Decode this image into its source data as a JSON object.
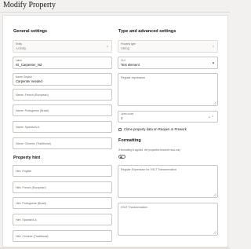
{
  "page": {
    "title": "Modify Property"
  },
  "general": {
    "title": "General settings",
    "entity": {
      "label": "Entity",
      "value": "Activity"
    },
    "label": {
      "label": "Label",
      "value": "IG_Carpenter_Nd"
    },
    "name_english": {
      "label": "Name: English",
      "value": "Carpenter needed"
    },
    "name_french": {
      "placeholder": "Name: French (European)"
    },
    "name_portuguese": {
      "placeholder": "Name: Portuguese (Brazil)"
    },
    "name_spanish": {
      "placeholder": "Name: Spanish/LA"
    },
    "name_chinese": {
      "placeholder": "Name: Chinese (Traditional)"
    }
  },
  "type_advanced": {
    "title": "Type and advanced settings",
    "property_type": {
      "label": "Property type",
      "value": "String"
    },
    "gui": {
      "label": "GUI",
      "value": "Text element"
    },
    "regex": {
      "placeholder": "Regular expression"
    },
    "lines_count": {
      "label": "Lines count",
      "value": "1"
    },
    "clone_checkbox": {
      "label": "Clone property data on Reopen or Prework",
      "checked": false
    }
  },
  "formatting": {
    "title": "Formatting",
    "hint": "If formatting is applied, the properties become read-only",
    "toggle_on": false,
    "regex_xslt": {
      "placeholder": "Regular Expression for XSLT Transformation"
    },
    "xslt": {
      "placeholder": "XSLT Transformation"
    }
  },
  "property_hint": {
    "title": "Property hint",
    "hint_english": {
      "placeholder": "Hint: English"
    },
    "hint_french": {
      "placeholder": "Hint: French (European)"
    },
    "hint_portuguese": {
      "placeholder": "Hint: Portuguese (Brazil)"
    },
    "hint_spanish": {
      "placeholder": "Hint: Spanish/LA"
    },
    "hint_chinese": {
      "placeholder": "Hint: Chinese (Traditional)"
    }
  },
  "icons": {
    "caret": "▾",
    "caret_up": "⌃",
    "clear": "×"
  }
}
